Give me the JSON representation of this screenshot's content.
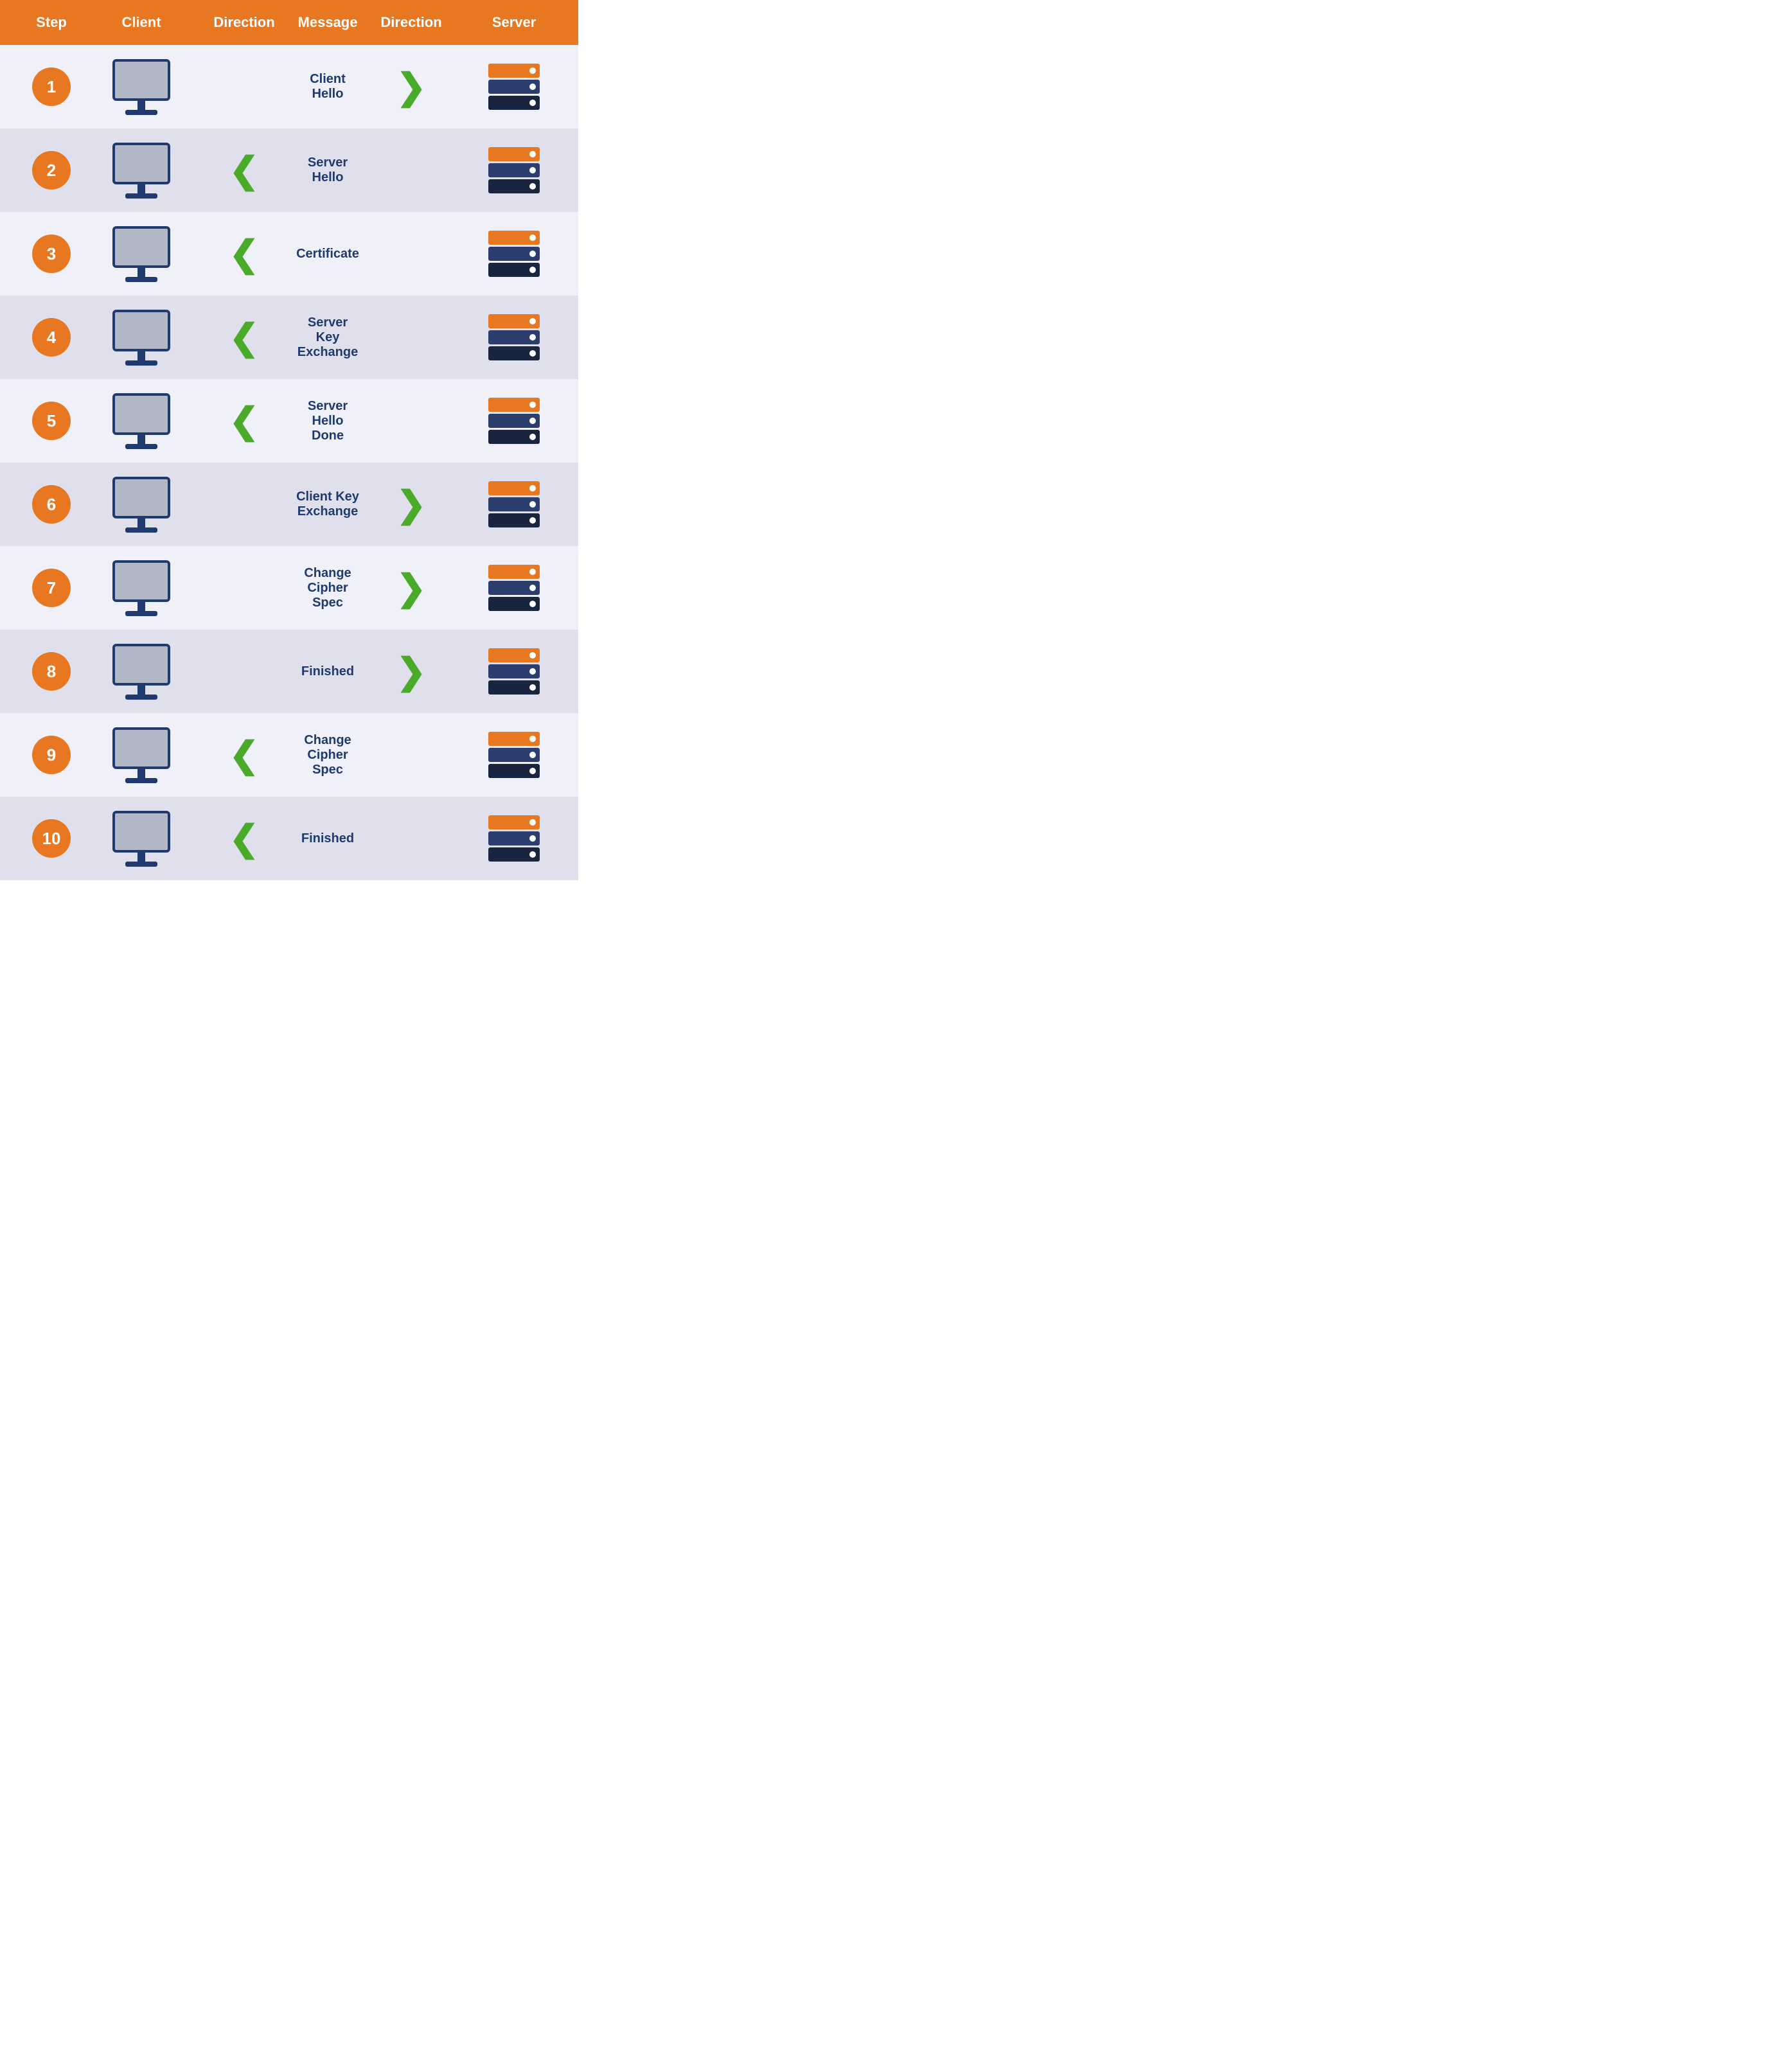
{
  "header": {
    "step": "Step",
    "client": "Client",
    "direction1": "Direction",
    "message": "Message",
    "direction2": "Direction",
    "server": "Server"
  },
  "rows": [
    {
      "step": "1",
      "message": "Client Hello",
      "dir_client": "",
      "dir_server": "right"
    },
    {
      "step": "2",
      "message": "Server Hello",
      "dir_client": "left",
      "dir_server": ""
    },
    {
      "step": "3",
      "message": "Certificate",
      "dir_client": "left",
      "dir_server": ""
    },
    {
      "step": "4",
      "message": "Server Key Exchange",
      "dir_client": "left",
      "dir_server": ""
    },
    {
      "step": "5",
      "message": "Server Hello Done",
      "dir_client": "left",
      "dir_server": ""
    },
    {
      "step": "6",
      "message": "Client Key Exchange",
      "dir_client": "",
      "dir_server": "right"
    },
    {
      "step": "7",
      "message": "Change Cipher Spec",
      "dir_client": "",
      "dir_server": "right"
    },
    {
      "step": "8",
      "message": "Finished",
      "dir_client": "",
      "dir_server": "right"
    },
    {
      "step": "9",
      "message": "Change Cipher Spec",
      "dir_client": "left",
      "dir_server": ""
    },
    {
      "step": "10",
      "message": "Finished",
      "dir_client": "left",
      "dir_server": ""
    }
  ]
}
